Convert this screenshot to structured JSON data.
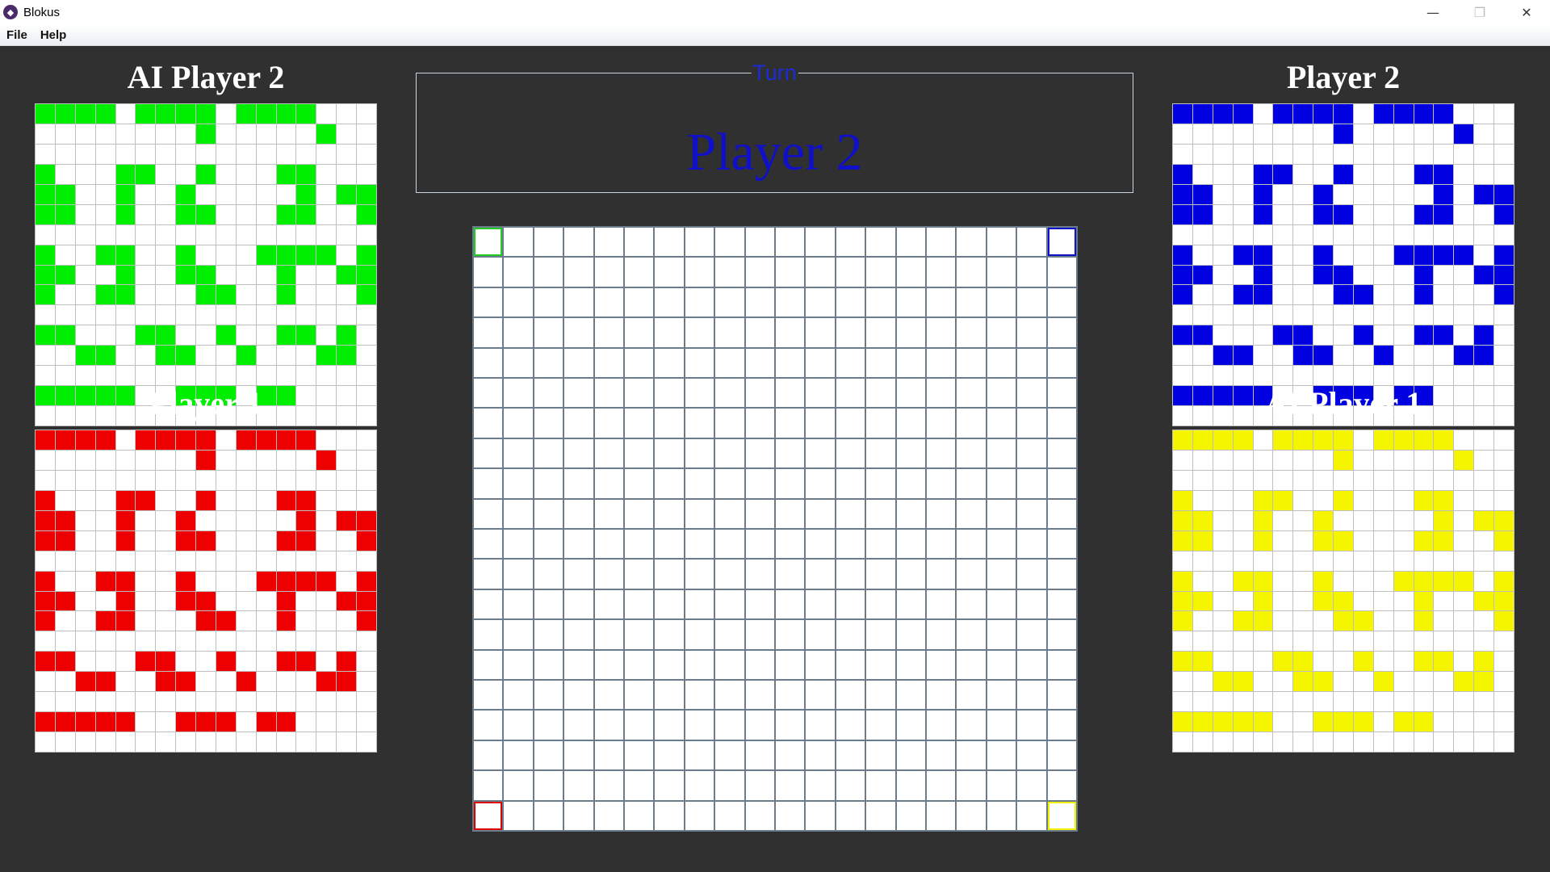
{
  "window": {
    "title": "Blokus",
    "app_icon": "blokus-app-icon",
    "controls": {
      "minimize": "—",
      "maximize": "❐",
      "close": "✕"
    }
  },
  "menu": [
    {
      "label": "File"
    },
    {
      "label": "Help"
    }
  ],
  "turn": {
    "legend": "Turn",
    "player": "Player 2",
    "player_color": "#1010c8"
  },
  "players": {
    "top_left": {
      "name": "AI Player 2",
      "color": "#00ee00",
      "grid": [
        "11110111101111000",
        "00000000100000100",
        "00000000000000000",
        "10001100100011000",
        "11001001000001011",
        "11001001100011001",
        "00000000000000000",
        "10011001000111101",
        "11001001100010011",
        "10011000110010001",
        "00000000000000000",
        "11000110010011010",
        "00110011001000110",
        "00000000000000000",
        "11111001110110000",
        "00000000000000000"
      ]
    },
    "bottom_left": {
      "name": "Player 1",
      "color": "#ee0000",
      "grid": [
        "11110111101111000",
        "00000000100000100",
        "00000000000000000",
        "10001100100011000",
        "11001001000001011",
        "11001001100011001",
        "00000000000000000",
        "10011001000111101",
        "11001001100010011",
        "10011000110010001",
        "00000000000000000",
        "11000110010011010",
        "00110011001000110",
        "00000000000000000",
        "11111001110110000",
        "00000000000000000"
      ]
    },
    "top_right": {
      "name": "Player 2",
      "color": "#0000e0",
      "grid": [
        "11110111101111000",
        "00000000100000100",
        "00000000000000000",
        "10001100100011000",
        "11001001000001011",
        "11001001100011001",
        "00000000000000000",
        "10011001000111101",
        "11001001100010011",
        "10011000110010001",
        "00000000000000000",
        "11000110010011010",
        "00110011001000110",
        "00000000000000000",
        "11111001110110000",
        "00000000000000000"
      ]
    },
    "bottom_right": {
      "name": "AI Player 1",
      "color": "#f5f500",
      "grid": [
        "11110111101111000",
        "00000000100000100",
        "00000000000000000",
        "10001100100011000",
        "11001001000001011",
        "11001001100011001",
        "00000000000000000",
        "10011001000111101",
        "11001001100010011",
        "10011000110010001",
        "00000000000000000",
        "11000110010011010",
        "00110011001000110",
        "00000000000000000",
        "11111001110110000",
        "00000000000000000"
      ]
    }
  },
  "board": {
    "size": 20,
    "start_corners": [
      {
        "corner": "top-left",
        "color": "#22cc22"
      },
      {
        "corner": "top-right",
        "color": "#1010c8"
      },
      {
        "corner": "bottom-left",
        "color": "#dd0000"
      },
      {
        "corner": "bottom-right",
        "color": "#f0f000"
      }
    ]
  }
}
